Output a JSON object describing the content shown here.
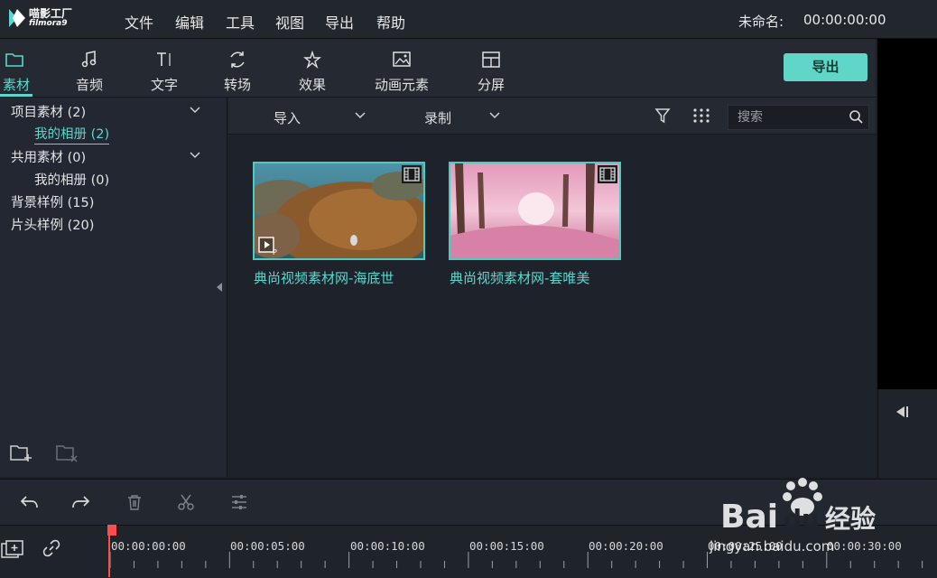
{
  "app": {
    "logo_cn": "喵影工厂",
    "logo_en": "filmora9",
    "menu": [
      "文件",
      "编辑",
      "工具",
      "视图",
      "导出",
      "帮助"
    ],
    "project_label": "未命名:",
    "project_time": "00:00:00:00"
  },
  "tabs": [
    {
      "label": "素材",
      "icon": "folder-icon",
      "active": true
    },
    {
      "label": "音频",
      "icon": "music-note-icon",
      "active": false
    },
    {
      "label": "文字",
      "icon": "text-icon",
      "active": false
    },
    {
      "label": "转场",
      "icon": "transition-icon",
      "active": false
    },
    {
      "label": "效果",
      "icon": "effects-icon",
      "active": false
    },
    {
      "label": "动画元素",
      "icon": "image-icon",
      "active": false
    },
    {
      "label": "分屏",
      "icon": "split-screen-icon",
      "active": false
    }
  ],
  "export_label": "导出",
  "library": [
    {
      "label": "项目素材 (2)",
      "expandable": true
    },
    {
      "label": "我的相册 (2)",
      "selected": true
    },
    {
      "label": "共用素材 (0)",
      "expandable": true
    },
    {
      "label": "我的相册 (0)"
    },
    {
      "label": "背景样例 (15)"
    },
    {
      "label": "片头样例 (20)"
    }
  ],
  "media_toolbar": {
    "import_label": "导入",
    "record_label": "录制",
    "search_placeholder": "搜索"
  },
  "media_items": [
    {
      "title": "典尚视频素材网-海底世",
      "kind": "video"
    },
    {
      "title": "典尚视频素材网-套唯美",
      "kind": "video"
    }
  ],
  "timeline": {
    "ticks": [
      "00:00:00:00",
      "00:00:05:00",
      "00:00:10:00",
      "00:00:15:00",
      "00:00:20:00",
      "00:00:25:00",
      "00:00:30:00"
    ]
  },
  "watermark": {
    "brand": "Bai du 经验",
    "site": "jingyan.baidu.com"
  },
  "colors": {
    "accent": "#5ad8cf",
    "export_button": "#5fd6c8",
    "playhead": "#ff4d4d"
  }
}
